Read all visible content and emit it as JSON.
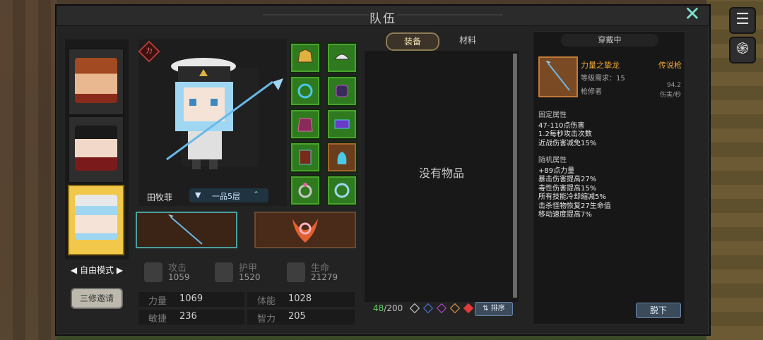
{
  "window": {
    "title": "队伍"
  },
  "characters": [
    {
      "name": "character-1",
      "hair": "#a24a22",
      "skin": "#e9b890"
    },
    {
      "name": "character-2",
      "hair": "#1a1a1a",
      "skin": "#f1d8c8"
    },
    {
      "name": "character-3",
      "hair": "#9fd7f2",
      "skin": "#f5e3d8",
      "selected": true
    }
  ],
  "mode": {
    "label": "自由模式",
    "left": "◀",
    "right": "▶"
  },
  "invite_label": "三修邀请",
  "hero": {
    "badge": "力",
    "name": "田牧菲",
    "rank": "一品5层"
  },
  "stats_main": [
    {
      "label": "攻击",
      "value": "1059"
    },
    {
      "label": "护甲",
      "value": "1520"
    },
    {
      "label": "生命",
      "value": "21279"
    }
  ],
  "attrs": [
    {
      "label": "力量",
      "value": "1069"
    },
    {
      "label": "体能",
      "value": "1028"
    },
    {
      "label": "敏捷",
      "value": "236"
    },
    {
      "label": "智力",
      "value": "205"
    }
  ],
  "tabs": [
    {
      "label": "装备"
    },
    {
      "label": "材料"
    }
  ],
  "inventory": {
    "empty_text": "没有物品",
    "count": "48",
    "max": "/200",
    "sort_label": "排序"
  },
  "filters": [
    "#d8d8d8",
    "#4a7de8",
    "#c04ad8",
    "#f0a040",
    "#e03a3a"
  ],
  "detail": {
    "header": "穿戴中",
    "item_name": "力量之挚龙",
    "item_type": "传说枪",
    "requirement": "等级需求：15",
    "class": "枪修者",
    "dps": "94.2",
    "dps_label": "伤害/秒",
    "fixed_title": "固定属性",
    "fixed": [
      "47-110点伤害",
      "1.2每秒攻击次数",
      "近战伤害减免15%"
    ],
    "random_title": "随机属性",
    "random": [
      "+89点力量",
      "暴击伤害提高27%",
      "毒性伤害提高15%",
      "所有技能冷却缩减5%",
      "击杀怪物恢复27生命值",
      "移动速度提高7%"
    ],
    "unequip": "脱下"
  }
}
